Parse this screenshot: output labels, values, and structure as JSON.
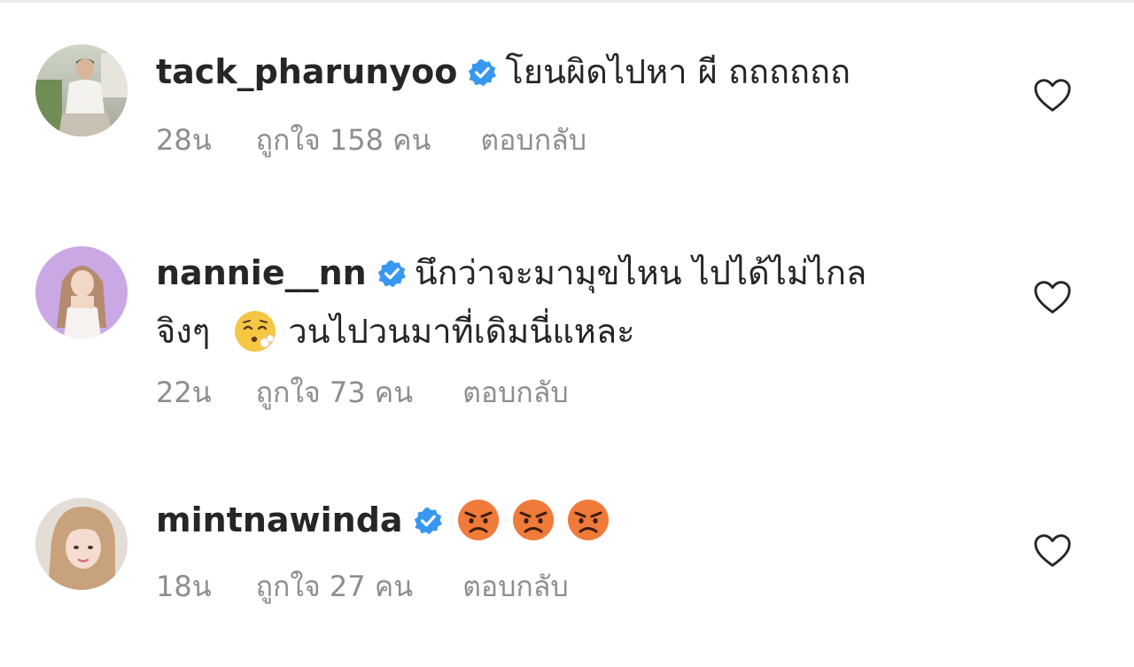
{
  "colors": {
    "text": "#262626",
    "meta": "#8e8e8e",
    "verified": "#3897f0",
    "heart_stroke": "#262626"
  },
  "comments": [
    {
      "username": "tack_pharunyoo",
      "verified": true,
      "lines": [
        "โยนผิดไปหา ผี ถถถถถถ"
      ],
      "time": "28น",
      "likes": "ถูกใจ 158 คน",
      "reply": "ตอบกลับ",
      "like_icon": "heart-outline-icon"
    },
    {
      "username": "nannie__nn",
      "verified": true,
      "lines": [
        "นึกว่าจะมามุขไหน ไปได้ไม่ไกล",
        "จิงๆ",
        "วนไปวนมาที่เดิมนี่แหละ"
      ],
      "emoji": "face-exhaling-emoji",
      "time": "22น",
      "likes": "ถูกใจ 73 คน",
      "reply": "ตอบกลับ",
      "like_icon": "heart-outline-icon"
    },
    {
      "username": "mintnawinda",
      "verified": true,
      "emojis": [
        "angry-face-emoji",
        "angry-face-emoji",
        "angry-face-emoji"
      ],
      "time": "18น",
      "likes": "ถูกใจ 27 คน",
      "reply": "ตอบกลับ",
      "like_icon": "heart-outline-icon"
    }
  ]
}
